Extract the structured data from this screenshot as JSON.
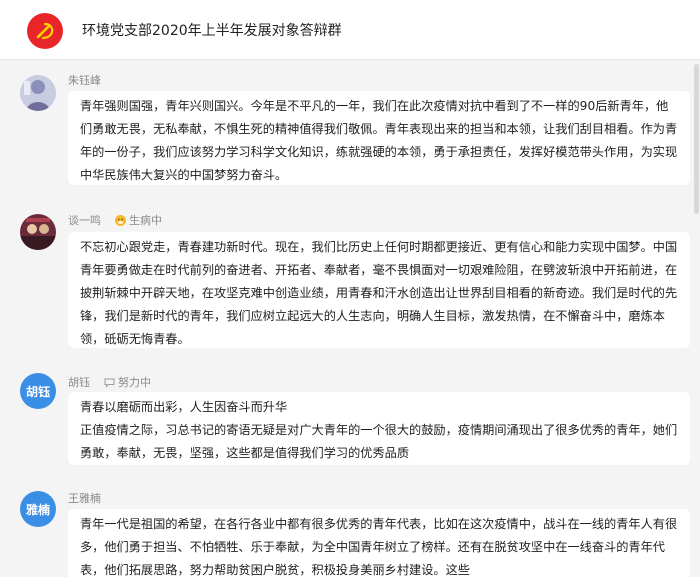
{
  "header": {
    "group_name": "环境党支部2020年上半年发展对象答辩群",
    "avatar_icon": "party-emblem-icon",
    "avatar_color": "#e8262a"
  },
  "messages": [
    {
      "sender": "朱钰峰",
      "status": "",
      "avatar_type": "photo",
      "text": "青年强则国强，青年兴则国兴。今年是不平凡的一年，我们在此次疫情对抗中看到了不一样的90后新青年，他们勇敢无畏，无私奉献，不惧生死的精神值得我们敬佩。青年表现出来的担当和本领，让我们刮目相看。作为青年的一份子，我们应该努力学习科学文化知识，练就强硬的本领，勇于承担责任，发挥好模范带头作用，为实现中华民族伟大复兴的中国梦努力奋斗。"
    },
    {
      "sender": "谈一鸣",
      "status": "生病中",
      "status_icon": "sick-emoji-icon",
      "avatar_type": "photo",
      "text": "不忘初心跟党走，青春建功新时代。现在，我们比历史上任何时期都更接近、更有信心和能力实现中国梦。中国青年要勇做走在时代前列的奋进者、开拓者、奉献者，毫不畏惧面对一切艰难险阻，在劈波斩浪中开拓前进，在披荆斩棘中开辟天地，在攻坚克难中创造业绩，用青春和汗水创造出让世界刮目相看的新奇迹。我们是时代的先锋，我们是新时代的青年，我们应树立起远大的人生志向，明确人生目标，激发热情，在不懈奋斗中，磨炼本领，砥砺无悔青春。"
    },
    {
      "sender": "胡钰",
      "status": "努力中",
      "status_icon": "chat-bubble-icon",
      "avatar_type": "text",
      "avatar_text": "胡钰",
      "lines": [
        "青春以磨砺而出彩，人生因奋斗而升华",
        "正值疫情之际，习总书记的寄语无疑是对广大青年的一个很大的鼓励，疫情期间涌现出了很多优秀的青年，她们勇敢，奉献，无畏，坚强，这些都是值得我们学习的优秀品质"
      ]
    },
    {
      "sender": "王雅楠",
      "status": "",
      "avatar_type": "text",
      "avatar_text": "雅楠",
      "text": "青年一代是祖国的希望，在各行各业中都有很多优秀的青年代表，比如在这次疫情中，战斗在一线的青年人有很多，他们勇于担当、不怕牺牲、乐于奉献，为全中国青年树立了榜样。还有在脱贫攻坚中在一线奋斗的青年代表，他们拓展思路，努力帮助贫困户脱贫，积极投身美丽乡村建设。这些"
    }
  ]
}
